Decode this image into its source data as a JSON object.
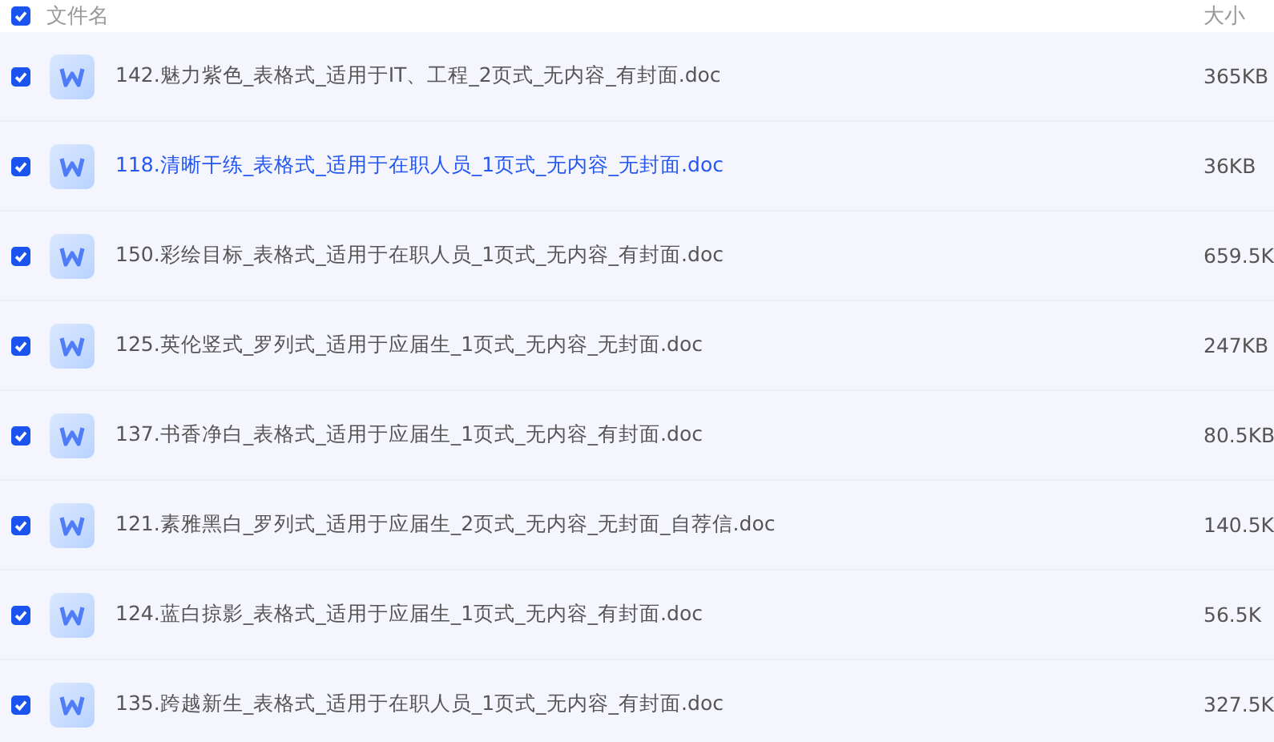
{
  "header": {
    "checked": true,
    "name": "文件名",
    "size": "大小"
  },
  "files": [
    {
      "name": "142.魅力紫色_表格式_适用于IT、工程_2页式_无内容_有封面.doc",
      "size": "365KB",
      "checked": true,
      "highlighted": false
    },
    {
      "name": "118.清晰干练_表格式_适用于在职人员_1页式_无内容_无封面.doc",
      "size": "36KB",
      "checked": true,
      "highlighted": true
    },
    {
      "name": "150.彩绘目标_表格式_适用于在职人员_1页式_无内容_有封面.doc",
      "size": "659.5K",
      "checked": true,
      "highlighted": false
    },
    {
      "name": "125.英伦竖式_罗列式_适用于应届生_1页式_无内容_无封面.doc",
      "size": "247KB",
      "checked": true,
      "highlighted": false
    },
    {
      "name": "137.书香净白_表格式_适用于应届生_1页式_无内容_有封面.doc",
      "size": "80.5KB",
      "checked": true,
      "highlighted": false
    },
    {
      "name": "121.素雅黑白_罗列式_适用于应届生_2页式_无内容_无封面_自荐信.doc",
      "size": "140.5K",
      "checked": true,
      "highlighted": false
    },
    {
      "name": "124.蓝白掠影_表格式_适用于应届生_1页式_无内容_有封面.doc",
      "size": "56.5K",
      "checked": true,
      "highlighted": false
    },
    {
      "name": "135.跨越新生_表格式_适用于在职人员_1页式_无内容_有封面.doc",
      "size": "327.5K",
      "checked": true,
      "highlighted": false
    }
  ]
}
